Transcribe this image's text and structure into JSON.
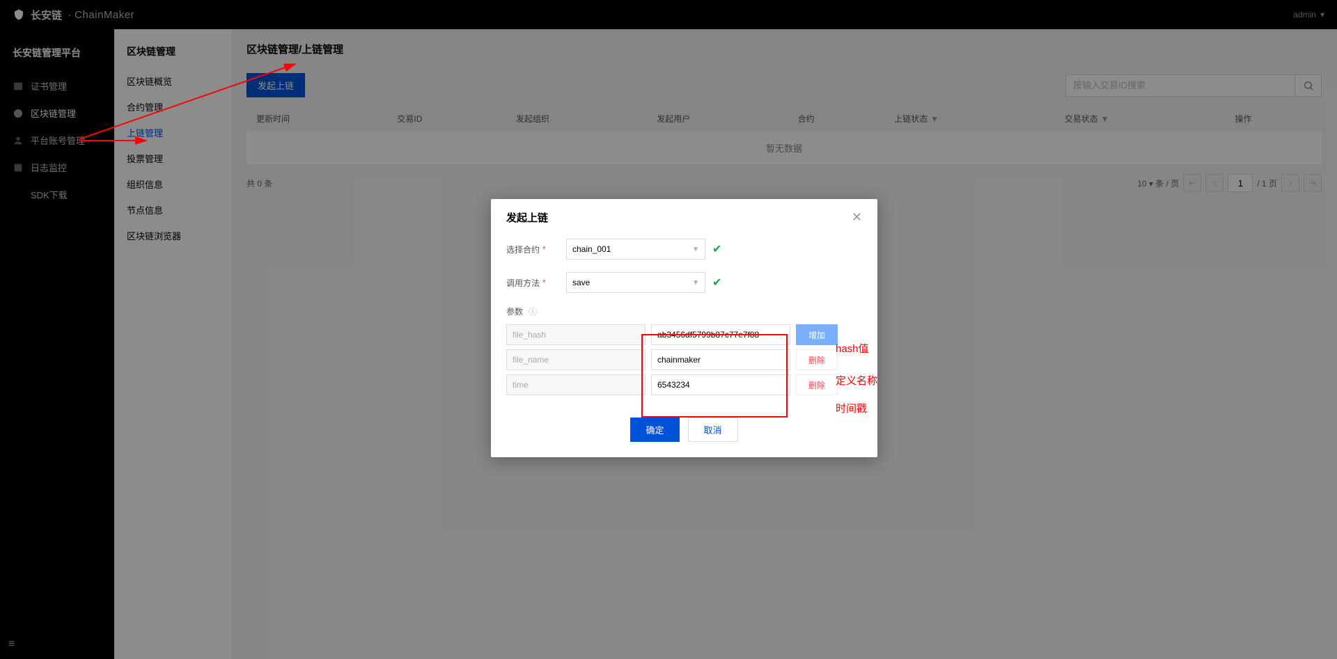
{
  "brand_cn": "长安链",
  "brand_en": "· ChainMaker",
  "user": "admin",
  "sidebar": {
    "title": "长安链管理平台",
    "items": [
      "证书管理",
      "区块链管理",
      "平台账号管理",
      "日志监控",
      "SDK下载"
    ]
  },
  "submenu": {
    "title": "区块链管理",
    "items": [
      "区块链概览",
      "合约管理",
      "上链管理",
      "投票管理",
      "组织信息",
      "节点信息",
      "区块链浏览器"
    ],
    "active": "上链管理"
  },
  "crumb": "区块链管理/上链管理",
  "btn_initiate": "发起上链",
  "search_placeholder": "按输入交易ID搜索",
  "table": {
    "headers": [
      "更新时间",
      "交易ID",
      "发起组织",
      "发起用户",
      "合约",
      "上链状态",
      "交易状态",
      "操作"
    ],
    "empty": "暂无数据"
  },
  "pager": {
    "total_label": "共 0 条",
    "page_size": "10",
    "page_size_suffix": "条 / 页",
    "page_current": "1",
    "page_total_label": "/ 1 页"
  },
  "modal": {
    "title": "发起上链",
    "contract_label": "选择合约",
    "contract_value": "chain_001",
    "method_label": "调用方法",
    "method_value": "save",
    "params_label": "参数",
    "params": [
      {
        "key": "file_hash",
        "val": "ab3456df5799b87c77e7f88",
        "btn": "增加",
        "btn_type": "add",
        "note": "hash值"
      },
      {
        "key": "file_name",
        "val": "chainmaker",
        "btn": "删除",
        "btn_type": "del",
        "note": "定义名称"
      },
      {
        "key": "time",
        "val": "6543234",
        "btn": "删除",
        "btn_type": "del",
        "note": "时间戳"
      }
    ],
    "ok": "确定",
    "cancel": "取消"
  }
}
